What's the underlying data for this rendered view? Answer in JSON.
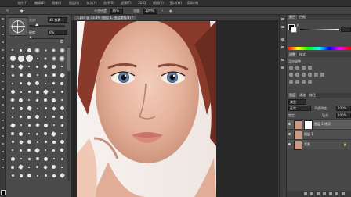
{
  "menubar": {
    "items": [
      "文件(F)",
      "编辑(E)",
      "图像(I)",
      "图层(L)",
      "文字(Y)",
      "选择(S)",
      "滤镜(T)",
      "3D(D)",
      "视图(V)",
      "窗口(W)",
      "帮助(H)"
    ]
  },
  "options": {
    "opacity_label": "不透明度:",
    "opacity_value": "36%",
    "flow_label": "流量:",
    "flow_value": "100%"
  },
  "brush_panel": {
    "size_label": "大小:",
    "size_value": "45 像素",
    "hardness_label": "硬度:",
    "hardness_value": "0%",
    "gear_icon": "gear-icon"
  },
  "document": {
    "tab_label": "1.psd @ 33.3% (图层 1, 图层蒙版/8) *"
  },
  "right_panel": {
    "color_tabs": [
      "颜色",
      "色板"
    ],
    "adjust_tabs": [
      "调整",
      "样式"
    ],
    "adjust_title": "添加调整",
    "layers_tabs": [
      "图层",
      "通道",
      "路径"
    ],
    "kind_label": "类型",
    "blend_mode": "正常",
    "opacity_label": "不透明度:",
    "opacity_value": "100%",
    "lock_label": "锁定:",
    "fill_label": "填充:",
    "fill_value": "100%",
    "layers": [
      {
        "name": "图层 1 拷贝",
        "has_mask": true,
        "selected": true
      },
      {
        "name": "图层 1",
        "has_mask": false,
        "selected": false
      },
      {
        "name": "背景",
        "has_mask": false,
        "selected": false
      }
    ]
  },
  "colors": {
    "panel": "#4b4b4b",
    "chrome": "#2e2e2e",
    "canvas": "#282828"
  }
}
